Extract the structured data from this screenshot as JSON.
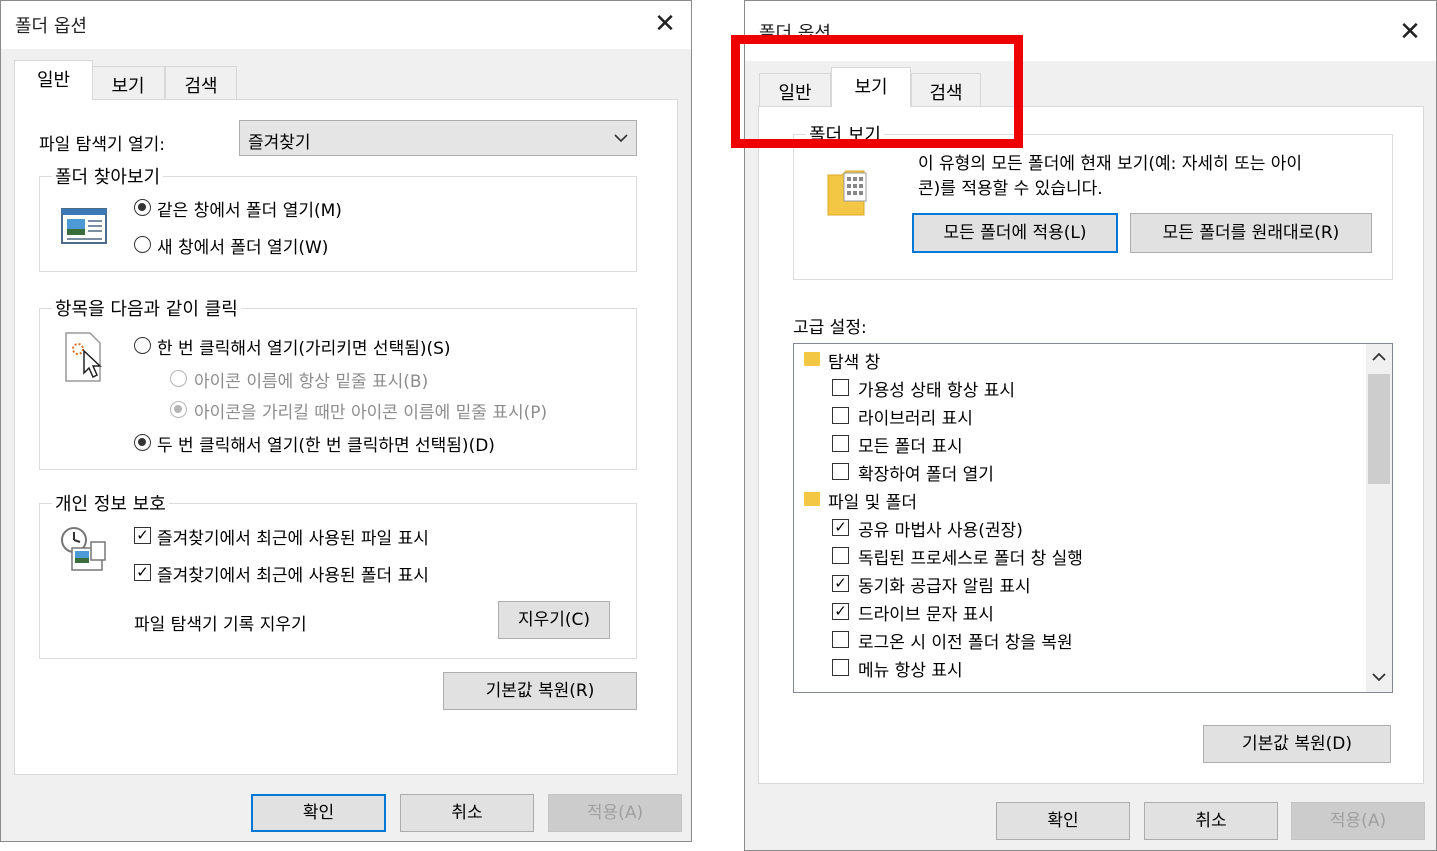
{
  "left": {
    "title": "폴더 옵션",
    "close": "✕",
    "tabs": [
      "일반",
      "보기",
      "검색"
    ],
    "explorer_label": "파일 탐색기 열기:",
    "explorer_value": "즐겨찾기",
    "browse_group": "폴더 찾아보기",
    "browse_same": "같은 창에서 폴더 열기(M)",
    "browse_new": "새 창에서 폴더 열기(W)",
    "click_group": "항목을 다음과 같이 클릭",
    "single_click": "한 번 클릭해서 열기(가리키면 선택됨)(S)",
    "underline_always": "아이콘 이름에 항상 밑줄 표시(B)",
    "underline_hover": "아이콘을 가리킬 때만 아이콘 이름에 밑줄 표시(P)",
    "double_click": "두 번 클릭해서 열기(한 번 클릭하면 선택됨)(D)",
    "privacy_group": "개인 정보 보호",
    "recent_files": "즐겨찾기에서 최근에 사용된 파일 표시",
    "recent_folders": "즐겨찾기에서 최근에 사용된 폴더 표시",
    "clear_history": "파일 탐색기 기록 지우기",
    "clear_button": "지우기(C)",
    "restore_defaults": "기본값 복원(R)",
    "ok": "확인",
    "cancel": "취소",
    "apply": "적용(A)"
  },
  "right": {
    "title": "폴더 옵션",
    "close": "✕",
    "tabs": [
      "일반",
      "보기",
      "검색"
    ],
    "folder_views_group": "폴더 보기",
    "folder_views_desc1": "이 유형의 모든 폴더에 현재 보기(예: 자세히 또는 아이",
    "folder_views_desc2": "콘)를 적용할 수 있습니다.",
    "apply_to_folders": "모든 폴더에 적용(L)",
    "reset_folders": "모든 폴더를 원래대로(R)",
    "advanced_label": "고급 설정:",
    "tree": [
      {
        "type": "category",
        "label": "탐색 창"
      },
      {
        "type": "check",
        "label": "가용성 상태 항상 표시",
        "checked": false
      },
      {
        "type": "check",
        "label": "라이브러리 표시",
        "checked": false
      },
      {
        "type": "check",
        "label": "모든 폴더 표시",
        "checked": false
      },
      {
        "type": "check",
        "label": "확장하여 폴더 열기",
        "checked": false
      },
      {
        "type": "category",
        "label": "파일 및 폴더"
      },
      {
        "type": "check",
        "label": "공유 마법사 사용(권장)",
        "checked": true
      },
      {
        "type": "check",
        "label": "독립된 프로세스로 폴더 창 실행",
        "checked": false
      },
      {
        "type": "check",
        "label": "동기화 공급자 알림 표시",
        "checked": true
      },
      {
        "type": "check",
        "label": "드라이브 문자 표시",
        "checked": true
      },
      {
        "type": "check",
        "label": "로그온 시 이전 폴더 창을 복원",
        "checked": false
      },
      {
        "type": "check",
        "label": "메뉴 항상 표시",
        "checked": false
      }
    ],
    "restore_defaults": "기본값 복원(D)",
    "ok": "확인",
    "cancel": "취소",
    "apply": "적용(A)"
  },
  "colors": {
    "highlight": "#ee0000",
    "focus_border": "#0078d7",
    "folder": "#f3c743"
  }
}
